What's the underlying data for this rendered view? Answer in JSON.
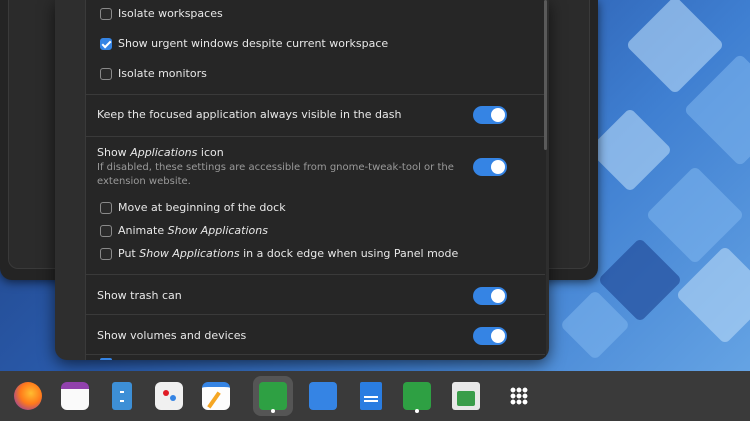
{
  "settings": {
    "isolate_workspaces": "Isolate workspaces",
    "show_urgent": "Show urgent windows despite current workspace",
    "isolate_monitors": "Isolate monitors",
    "keep_focused": "Keep the focused application always visible in the dash",
    "show_apps_prefix": "Show ",
    "show_apps_em": "Applications",
    "show_apps_suffix": " icon",
    "show_apps_sub": "If disabled, these settings are accessible from gnome-tweak-tool or the extension website.",
    "move_beginning": "Move at beginning of the dock",
    "animate_prefix": "Animate ",
    "animate_em": "Show Applications",
    "put_prefix": "Put ",
    "put_em": "Show Applications",
    "put_suffix": " in a dock edge when using Panel mode",
    "show_trash": "Show trash can",
    "show_volumes": "Show volumes and devices"
  },
  "states": {
    "isolate_workspaces": false,
    "show_urgent": true,
    "isolate_monitors": false,
    "keep_focused": true,
    "show_apps_icon": true,
    "move_beginning": false,
    "animate": false,
    "put_edge": false,
    "show_trash": true,
    "show_volumes": true
  },
  "dock": {
    "items": [
      {
        "icon": "firefox-icon",
        "color": "#e66000"
      },
      {
        "icon": "calendar-icon",
        "color": "#ffffff"
      },
      {
        "icon": "file-cabinet-icon",
        "color": "#3d8fd6"
      },
      {
        "icon": "software-store-icon",
        "color": "#f2f2f2"
      },
      {
        "icon": "text-editor-icon",
        "color": "#ffffff"
      },
      {
        "icon": "extensions-icon",
        "color": "#2ea043"
      },
      {
        "icon": "puzzle-icon",
        "color": "#3584e4"
      },
      {
        "icon": "writer-document-icon",
        "color": "#2a7de1"
      },
      {
        "icon": "extensions-green-icon",
        "color": "#2ea043"
      },
      {
        "icon": "trash-icon",
        "color": "#3a9d4a"
      },
      {
        "icon": "app-grid-icon",
        "color": "#ffffff"
      }
    ],
    "active_index": 5
  },
  "colors": {
    "accent": "#3584e4"
  }
}
